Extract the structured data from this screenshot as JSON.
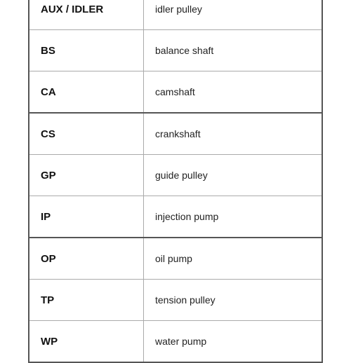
{
  "table": {
    "rows": [
      {
        "code": "AUX / IDLER",
        "description": "idler pulley",
        "thick_bottom": false
      },
      {
        "code": "BS",
        "description": "balance shaft",
        "thick_bottom": false
      },
      {
        "code": "CA",
        "description": "camshaft",
        "thick_bottom": true
      },
      {
        "code": "CS",
        "description": "crankshaft",
        "thick_bottom": false
      },
      {
        "code": "GP",
        "description": "guide pulley",
        "thick_bottom": false
      },
      {
        "code": "IP",
        "description": "injection pump",
        "thick_bottom": true
      },
      {
        "code": "OP",
        "description": "oil pump",
        "thick_bottom": false
      },
      {
        "code": "TP",
        "description": "tension pulley",
        "thick_bottom": false
      },
      {
        "code": "WP",
        "description": "water pump",
        "thick_bottom": false
      }
    ]
  }
}
